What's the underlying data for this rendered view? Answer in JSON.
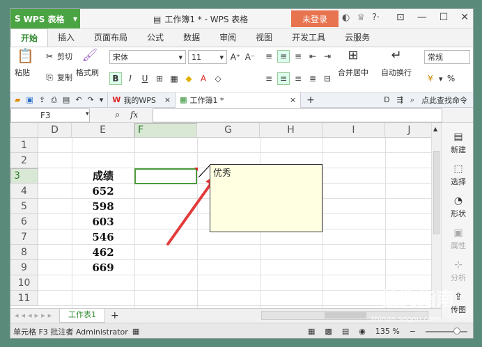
{
  "app": {
    "name": "WPS 表格",
    "doc_title": "工作簿1 * - WPS 表格",
    "login_label": "未登录"
  },
  "menu": [
    "开始",
    "插入",
    "页面布局",
    "公式",
    "数据",
    "审阅",
    "视图",
    "开发工具",
    "云服务"
  ],
  "ribbon": {
    "paste": "粘贴",
    "cut": "剪切",
    "copy": "复制",
    "format_painter": "格式刷",
    "font_name": "宋体",
    "font_size": "11",
    "merge_center": "合并居中",
    "wrap_text": "自动换行",
    "number_format": "常规",
    "percent": "%"
  },
  "doc_tabs": {
    "mywps": "我的WPS",
    "workbook": "工作簿1 *",
    "search": "点此查找命令"
  },
  "formula": {
    "name_box": "F3",
    "fx": "fx",
    "value": ""
  },
  "grid": {
    "columns": [
      "D",
      "E",
      "F",
      "G",
      "H",
      "I",
      "J"
    ],
    "rows": [
      "1",
      "2",
      "3",
      "4",
      "5",
      "6",
      "7",
      "8",
      "9",
      "10",
      "11"
    ],
    "header_text": "成绩",
    "scores": [
      "652",
      "598",
      "603",
      "546",
      "462",
      "669"
    ]
  },
  "comment": {
    "text": "优秀"
  },
  "sidepanel": [
    "新建",
    "选择",
    "形状",
    "属性",
    "分析",
    "传图"
  ],
  "sheet": {
    "name": "工作表1"
  },
  "status": {
    "cell_info": "单元格 F3 批注者 Administrator",
    "zoom": "135 %"
  },
  "watermark": {
    "brand": "搜狗指南",
    "url": "zhinan.sogou.com"
  },
  "colors": {
    "accent": "#4aa443",
    "login": "#e8734f",
    "arrow": "#e23b3b",
    "comment_bg": "#ffffe1"
  }
}
